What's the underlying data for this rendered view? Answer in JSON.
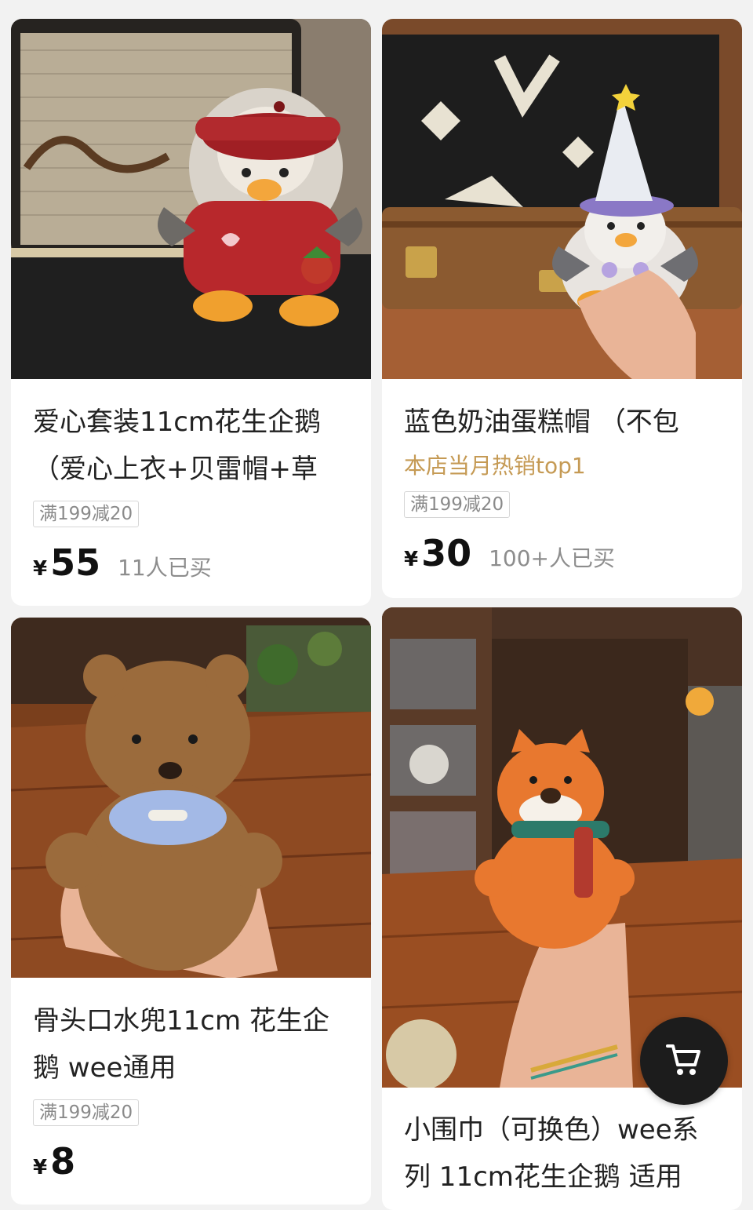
{
  "currency_symbol": "¥",
  "products": [
    {
      "image_alt": "红色贝雷帽毛线企鹅",
      "title_line1": "爱心套装11cm花生企鹅",
      "title_line2": "（爱心上衣+贝雷帽+草",
      "coupon": "满199减20",
      "price": "55",
      "sold": "11人已买"
    },
    {
      "image_alt": "蓝色奶油蛋糕帽毛线企鹅",
      "title_line1": "蓝色奶油蛋糕帽 （不包",
      "hot_tag": "本店当月热销top1",
      "coupon": "满199减20",
      "price": "30",
      "sold": "100+人已买"
    },
    {
      "image_alt": "骨头口水兜小熊",
      "title_line1": "骨头口水兜11cm 花生企",
      "title_line2": "鹅 wee通用",
      "coupon": "满199减20",
      "price": "8"
    },
    {
      "image_alt": "小围巾狐狸",
      "title_line1": "小围巾（可换色）wee系",
      "title_line2": "列 11cm花生企鹅 适用"
    }
  ],
  "floating_cart": {
    "icon": "shopping-cart-icon"
  }
}
